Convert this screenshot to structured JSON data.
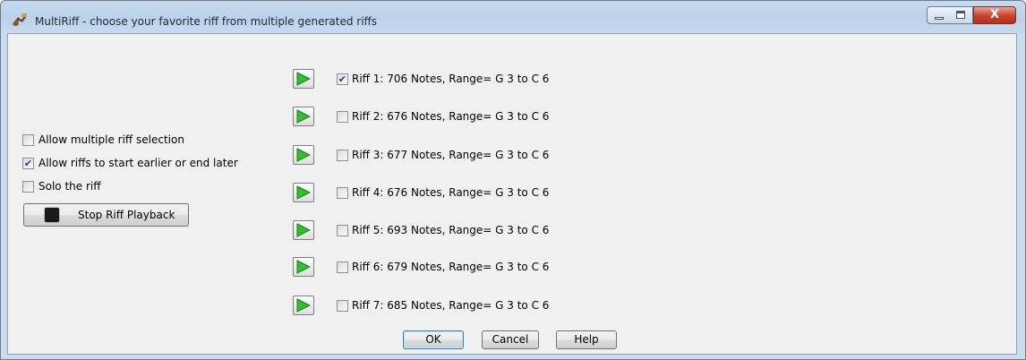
{
  "window": {
    "title": "MultiRiff - choose your favorite riff from multiple generated riffs",
    "controls": {
      "minimize": "minimize",
      "maximize": "maximize",
      "close": "X"
    }
  },
  "options": [
    {
      "label": "Allow multiple riff selection",
      "checked": false
    },
    {
      "label": "Allow riffs to start earlier or end later",
      "checked": true
    },
    {
      "label": "Solo the riff",
      "checked": false
    }
  ],
  "stop_button": {
    "label": "Stop Riff Playback"
  },
  "riffs": [
    {
      "label": "Riff 1: 706 Notes, Range= G 3  to C 6",
      "checked": true
    },
    {
      "label": "Riff 2: 676 Notes, Range= G 3  to C 6",
      "checked": false
    },
    {
      "label": "Riff 3: 677 Notes, Range= G 3  to C 6",
      "checked": false
    },
    {
      "label": "Riff 4: 676 Notes, Range= G 3  to C 6",
      "checked": false
    },
    {
      "label": "Riff 5: 693 Notes, Range= G 3  to C 6",
      "checked": false
    },
    {
      "label": "Riff 6: 679 Notes, Range= G 3  to C 6",
      "checked": false
    },
    {
      "label": "Riff 7: 685 Notes, Range= G 3  to C 6",
      "checked": false
    }
  ],
  "footer": {
    "ok": "OK",
    "cancel": "Cancel",
    "help": "Help"
  },
  "colors": {
    "play_green": "#2fbf2f",
    "check_blue": "#1f3c88"
  }
}
